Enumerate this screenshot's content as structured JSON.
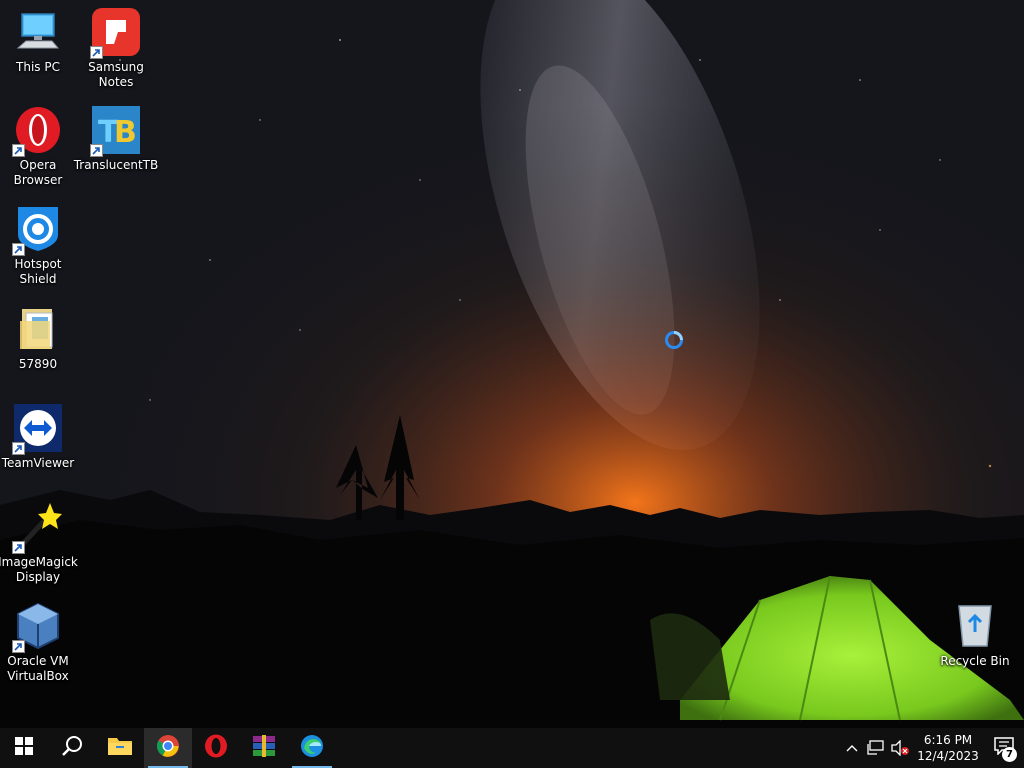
{
  "desktop": {
    "icons": [
      {
        "label": "This PC",
        "icon": "this-pc-icon"
      },
      {
        "label": "Samsung Notes",
        "icon": "samsung-notes-icon"
      },
      {
        "label": "Opera Browser",
        "icon": "opera-icon"
      },
      {
        "label": "TranslucentTB",
        "icon": "translucenttb-icon"
      },
      {
        "label": "Hotspot Shield",
        "icon": "hotspot-shield-icon"
      },
      {
        "label": "57890",
        "icon": "folder-icon"
      },
      {
        "label": "TeamViewer",
        "icon": "teamviewer-icon"
      },
      {
        "label": "ImageMagick Display",
        "icon": "imagemagick-icon"
      },
      {
        "label": "Oracle VM VirtualBox",
        "icon": "virtualbox-icon"
      },
      {
        "label": "Recycle Bin",
        "icon": "recycle-bin-icon"
      }
    ]
  },
  "taskbar": {
    "apps": [
      {
        "name": "start-button",
        "icon": "windows-logo-icon"
      },
      {
        "name": "search-button",
        "icon": "search-icon"
      },
      {
        "name": "file-explorer",
        "icon": "folder-icon"
      },
      {
        "name": "google-chrome",
        "icon": "chrome-icon"
      },
      {
        "name": "opera",
        "icon": "opera-icon"
      },
      {
        "name": "winrar",
        "icon": "winrar-icon"
      },
      {
        "name": "microsoft-edge",
        "icon": "edge-icon"
      }
    ],
    "tray": {
      "icons": [
        "chevron-up-icon",
        "network-icon",
        "volume-muted-icon"
      ],
      "time": "6:16 PM",
      "date": "12/4/2023",
      "notification_count": "7"
    }
  },
  "colors": {
    "taskbar_bg": "#101010",
    "running_indicator": "#76b9ed",
    "tent_green": "#8fe62a",
    "horizon_glow": "#e0661c"
  }
}
